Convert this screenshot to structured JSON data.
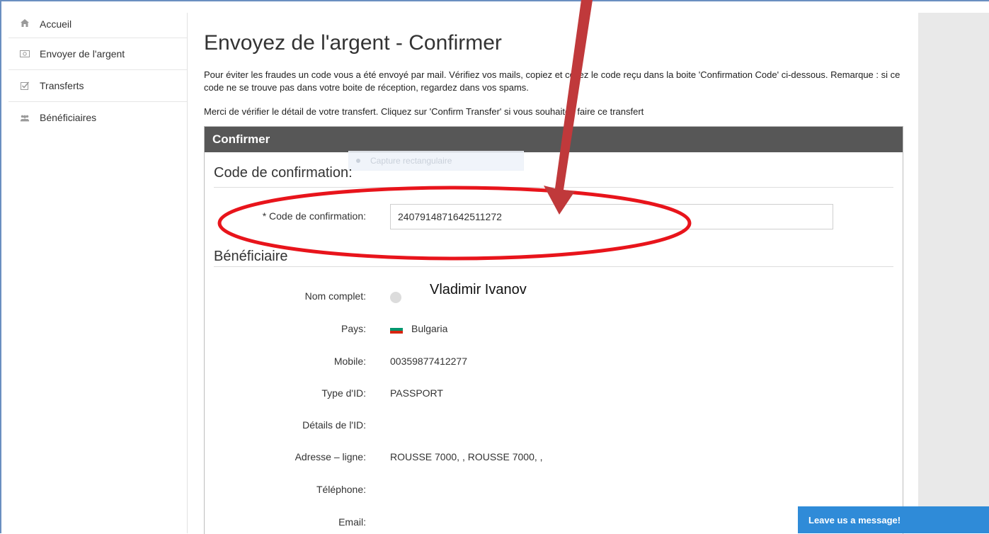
{
  "sidebar": {
    "items": [
      {
        "label": "Accueil",
        "icon": "home-icon"
      },
      {
        "label": "Envoyer de l'argent",
        "icon": "money-icon"
      },
      {
        "label": "Transferts",
        "icon": "checkbox-icon"
      },
      {
        "label": "Bénéficiaires",
        "icon": "users-icon"
      }
    ]
  },
  "page": {
    "title": "Envoyez de l'argent - Confirmer",
    "intro": "Pour éviter les fraudes un code vous a été envoyé par mail. Vérifiez vos mails, copiez et collez le code reçu dans la boite 'Confirmation Code' ci-dessous. Remarque : si ce code ne se trouve pas dans votre boite de réception, regardez dans vos spams.",
    "intro2": "Merci de vérifier le détail de votre transfert. Cliquez sur 'Confirm Transfer' si vous souhaitez faire ce transfert"
  },
  "panel": {
    "header": "Confirmer",
    "capture_overlay": "Capture rectangulaire",
    "code_section_title": "Code de confirmation:",
    "code_label": "* Code de confirmation:",
    "code_value": "2407914871642511272",
    "beneficiary_section_title": "Bénéficiaire",
    "fields": [
      {
        "label": "Nom complet:",
        "value": "Vladimir Ivanov"
      },
      {
        "label": "Pays:",
        "value": "Bulgaria"
      },
      {
        "label": "Mobile:",
        "value": "00359877412277"
      },
      {
        "label": "Type d'ID:",
        "value": "PASSPORT"
      },
      {
        "label": "Détails de l'ID:",
        "value": ""
      },
      {
        "label": "Adresse – ligne:",
        "value": "ROUSSE 7000, , ROUSSE 7000, ,"
      },
      {
        "label": "Téléphone:",
        "value": ""
      },
      {
        "label": "Email:",
        "value": ""
      }
    ]
  },
  "chat": {
    "label": "Leave us a message!"
  },
  "colors": {
    "panel_header": "#575757",
    "annotation": "#e8141b",
    "arrow": "#c0393b",
    "chat": "#2f8bd8",
    "flag": [
      "#ffffff",
      "#00966e",
      "#d62612"
    ]
  }
}
